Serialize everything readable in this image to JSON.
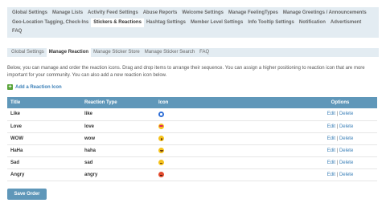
{
  "main_tabs": {
    "row1": [
      {
        "label": "Global Settings",
        "active": false
      },
      {
        "label": "Manage Lists",
        "active": false
      },
      {
        "label": "Activity Feed Settings",
        "active": false
      },
      {
        "label": "Abuse Reports",
        "active": false
      },
      {
        "label": "Welcome Settings",
        "active": false
      },
      {
        "label": "Manage FeelingTypes",
        "active": false
      },
      {
        "label": "Manage Greetings / Announcements",
        "active": false
      }
    ],
    "row2": [
      {
        "label": "Geo-Location Tagging, Check-Ins",
        "active": false
      },
      {
        "label": "Stickers & Reactions",
        "active": true
      },
      {
        "label": "Hashtag Settings",
        "active": false
      },
      {
        "label": "Member Level Settings",
        "active": false
      },
      {
        "label": "Info Tooltip Settings",
        "active": false
      },
      {
        "label": "Notification",
        "active": false
      },
      {
        "label": "Advertisment",
        "active": false
      }
    ],
    "row3": [
      {
        "label": "FAQ",
        "active": false
      }
    ]
  },
  "sub_tabs": [
    {
      "label": "Global Settings",
      "active": false
    },
    {
      "label": "Manage Reaction",
      "active": true
    },
    {
      "label": "Manage Sticker Store",
      "active": false
    },
    {
      "label": "Manage Sticker Search",
      "active": false
    },
    {
      "label": "FAQ",
      "active": false
    }
  ],
  "description": "Below, you can manage and order the reaction icons. Drag and drop items to arrange their sequence. You can assign a higher positioning to reaction icon that are more important for your community. You can also add a new reaction icon below.",
  "add_link": {
    "label": "Add a Reaction Icon",
    "icon": "plus-icon"
  },
  "table": {
    "headers": {
      "title": "Title",
      "type": "Reaction Type",
      "icon": "Icon",
      "options": "Options"
    },
    "rows": [
      {
        "title": "Like",
        "type": "like",
        "icon": "like"
      },
      {
        "title": "Love",
        "type": "love",
        "icon": "love"
      },
      {
        "title": "WOW",
        "type": "wow",
        "icon": "wow"
      },
      {
        "title": "HaHa",
        "type": "haha",
        "icon": "haha"
      },
      {
        "title": "Sad",
        "type": "sad",
        "icon": "sad"
      },
      {
        "title": "Angry",
        "type": "angry",
        "icon": "angry"
      }
    ],
    "edit_label": "Edit",
    "separator": "|",
    "delete_label": "Delete"
  },
  "save_button": {
    "label": "Save Order"
  },
  "colors": {
    "accent": "#5f97b9",
    "tab_bar": "#e3ecf2",
    "link": "#3a7fb7"
  }
}
